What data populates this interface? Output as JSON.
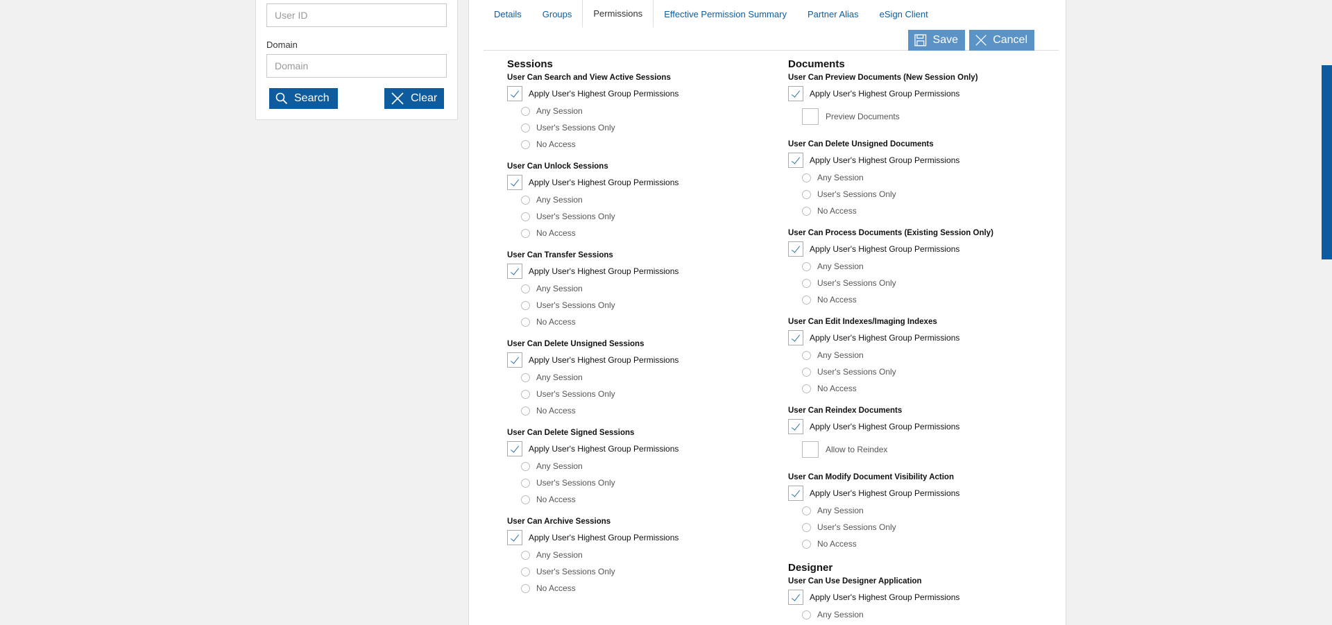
{
  "search_panel": {
    "user_id_placeholder": "User ID",
    "domain_label": "Domain",
    "domain_placeholder": "Domain",
    "search_label": "Search",
    "clear_label": "Clear"
  },
  "tabs": [
    "Details",
    "Groups",
    "Permissions",
    "Effective Permission Summary",
    "Partner Alias",
    "eSign Client"
  ],
  "active_tab": "Permissions",
  "actions": {
    "save_label": "Save",
    "cancel_label": "Cancel"
  },
  "apply_label": "Apply User's Highest Group Permissions",
  "radio_options": [
    "Any Session",
    "User's Sessions Only",
    "No Access"
  ],
  "sessions": {
    "title": "Sessions",
    "perms": [
      "User Can Search and View Active Sessions",
      "User Can Unlock Sessions",
      "User Can Transfer Sessions",
      "User Can Delete Unsigned Sessions",
      "User Can Delete Signed Sessions",
      "User Can Archive Sessions"
    ]
  },
  "documents": {
    "title": "Documents",
    "preview_title": "User Can Preview Documents (New Session Only)",
    "preview_option": "Preview Documents",
    "delete_unsigned_title": "User Can Delete Unsigned Documents",
    "process_title": "User Can Process Documents (Existing Session Only)",
    "edit_indexes_title": "User Can Edit Indexes/Imaging Indexes",
    "reindex_title": "User Can Reindex Documents",
    "reindex_option": "Allow to Reindex",
    "visibility_title": "User Can Modify Document Visibility Action"
  },
  "designer": {
    "title": "Designer",
    "use_app_title": "User Can Use Designer Application",
    "first_option": "Any Session"
  },
  "colors": {
    "brand_blue": "#0e5c9e",
    "action_blue": "#5b93c7",
    "link_blue": "#0e5c9e"
  }
}
